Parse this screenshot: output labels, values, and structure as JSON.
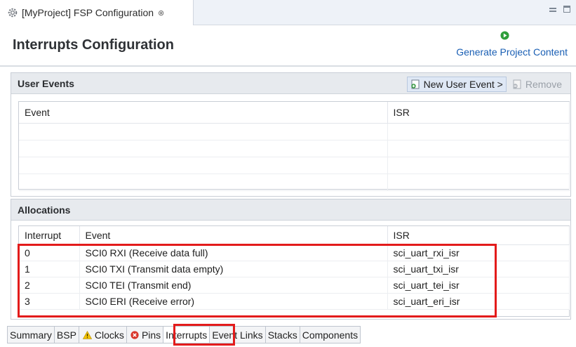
{
  "editor_tab": {
    "title": "[MyProject] FSP Configuration",
    "close_glyph": "⊗"
  },
  "header": {
    "title": "Interrupts Configuration",
    "generate_label": "Generate Project Content"
  },
  "user_events": {
    "title": "User Events",
    "new_button_label": "New User Event >",
    "remove_button_label": "Remove",
    "columns": [
      "Event",
      "ISR"
    ]
  },
  "allocations": {
    "title": "Allocations",
    "columns": [
      "Interrupt",
      "Event",
      "ISR"
    ],
    "rows": [
      {
        "interrupt": "0",
        "event": "SCI0 RXI (Receive data full)",
        "isr": "sci_uart_rxi_isr"
      },
      {
        "interrupt": "1",
        "event": "SCI0 TXI (Transmit data empty)",
        "isr": "sci_uart_txi_isr"
      },
      {
        "interrupt": "2",
        "event": "SCI0 TEI (Transmit end)",
        "isr": "sci_uart_tei_isr"
      },
      {
        "interrupt": "3",
        "event": "SCI0 ERI (Receive error)",
        "isr": "sci_uart_eri_isr"
      }
    ]
  },
  "bottom_tabs": [
    {
      "label": "Summary",
      "icon": ""
    },
    {
      "label": "BSP",
      "icon": ""
    },
    {
      "label": "Clocks",
      "icon": "warning-icon"
    },
    {
      "label": "Pins",
      "icon": "error-icon"
    },
    {
      "label": "Interrupts",
      "icon": "",
      "active": true
    },
    {
      "label": "Event Links",
      "icon": ""
    },
    {
      "label": "Stacks",
      "icon": ""
    },
    {
      "label": "Components",
      "icon": ""
    }
  ],
  "colors": {
    "accent": "#1a5fb4",
    "highlight": "#e31b1b",
    "run_green": "#2e9e3a"
  }
}
